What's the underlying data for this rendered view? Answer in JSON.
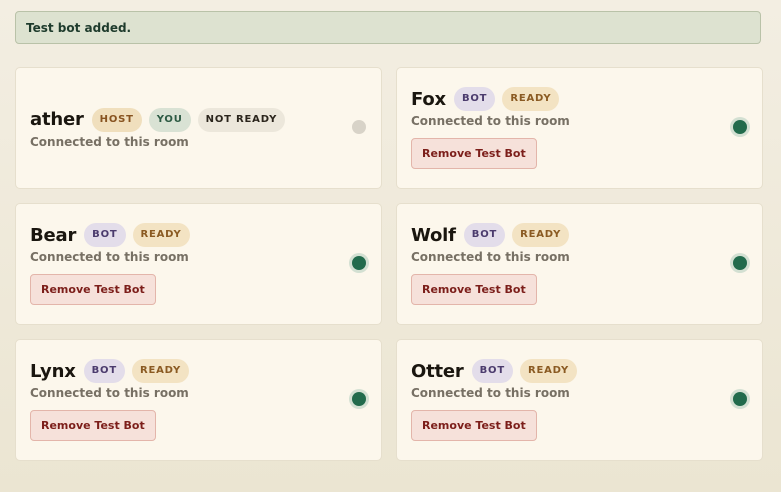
{
  "toast": {
    "message": "Test bot added."
  },
  "cards": [
    {
      "name": "ather",
      "badges": [
        "HOST",
        "YOU",
        "NOT READY"
      ],
      "status": "Connected to this room",
      "has_remove": false,
      "online": false
    },
    {
      "name": "Fox",
      "badges": [
        "BOT",
        "READY"
      ],
      "status": "Connected to this room",
      "has_remove": true,
      "remove_label": "Remove Test Bot",
      "online": true
    },
    {
      "name": "Bear",
      "badges": [
        "BOT",
        "READY"
      ],
      "status": "Connected to this room",
      "has_remove": true,
      "remove_label": "Remove Test Bot",
      "online": true
    },
    {
      "name": "Wolf",
      "badges": [
        "BOT",
        "READY"
      ],
      "status": "Connected to this room",
      "has_remove": true,
      "remove_label": "Remove Test Bot",
      "online": true
    },
    {
      "name": "Lynx",
      "badges": [
        "BOT",
        "READY"
      ],
      "status": "Connected to this room",
      "has_remove": true,
      "remove_label": "Remove Test Bot",
      "online": true
    },
    {
      "name": "Otter",
      "badges": [
        "BOT",
        "READY"
      ],
      "status": "Connected to this room",
      "has_remove": true,
      "remove_label": "Remove Test Bot",
      "online": true
    }
  ],
  "colors": {
    "online": "#226b4c",
    "offline": "#d8d3c8",
    "remove_text": "#7c1e1a",
    "toast_bg": "#dde2d0"
  }
}
